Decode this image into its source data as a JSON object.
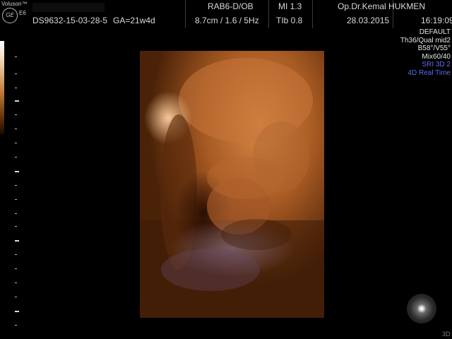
{
  "header": {
    "brand": "Voluson™",
    "logo_text": "GE",
    "model": "E6",
    "patient_id": "DS9632-15-03-28-5",
    "gestational_age": "GA=21w4d",
    "probe": "RAB6-D/OB",
    "depth_freq": "8.7cm / 1.6 / 5Hz",
    "mi": "MI  1.3",
    "tib": "TIb  0.8",
    "doctor": "Op.Dr.Kemal HUKMEN",
    "date": "28.03.2015",
    "time": "16:19:09"
  },
  "info_panel": {
    "lines_white": [
      "DEFAULT",
      "Th36/Qual mid2",
      "B58°/V55°",
      "Mix60/40"
    ],
    "lines_blue": [
      "SRI 3D 2",
      "4D Real Time"
    ]
  },
  "footer": {
    "mode_label": "3D"
  },
  "colors": {
    "background": "#000000",
    "accent_blue": "#5b6cf0",
    "skin_tone": "#c0733a"
  }
}
